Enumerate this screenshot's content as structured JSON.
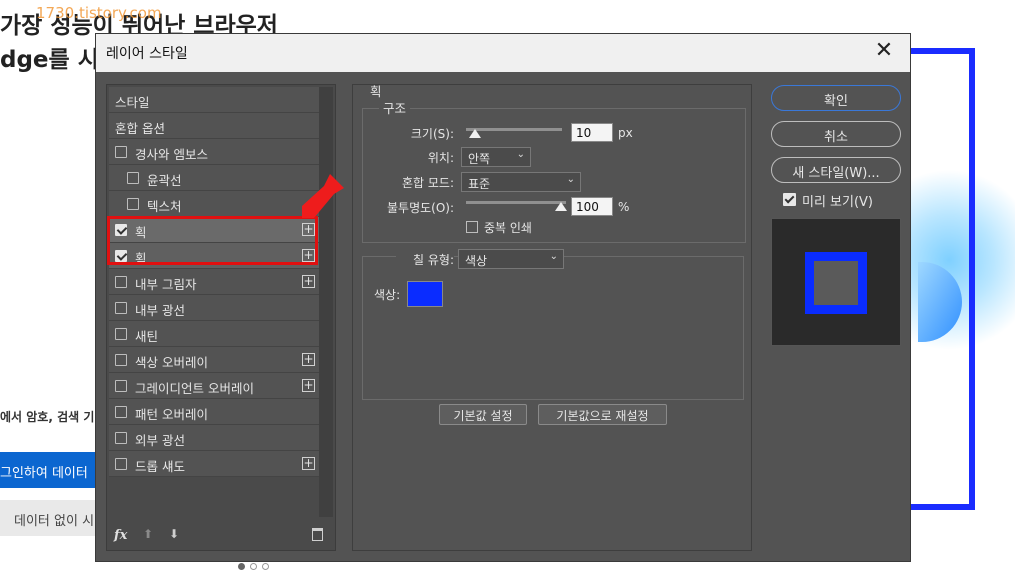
{
  "background": {
    "watermark": "1730.tistory.com",
    "title_line1": "가장 성능이 뛰어난 브라우저",
    "title_line2": "dge를 시작",
    "body_text": "에서 암호, 검색 기",
    "button1": "그인하여 데이터",
    "button2": "데이터 없이 시"
  },
  "dialog": {
    "title": "레이어 스타일",
    "close": "✕"
  },
  "left_list": {
    "items": [
      {
        "label": "스타일",
        "checkbox": false,
        "checked": false,
        "plus": false,
        "indent": 0
      },
      {
        "label": "혼합 옵션",
        "checkbox": false,
        "checked": false,
        "plus": false,
        "indent": 0
      },
      {
        "label": "경사와 엠보스",
        "checkbox": true,
        "checked": false,
        "plus": false,
        "indent": 0
      },
      {
        "label": "윤곽선",
        "checkbox": true,
        "checked": false,
        "plus": false,
        "indent": 1
      },
      {
        "label": "텍스처",
        "checkbox": true,
        "checked": false,
        "plus": false,
        "indent": 1
      },
      {
        "label": "획",
        "checkbox": true,
        "checked": true,
        "plus": true,
        "indent": 0,
        "selected": true
      },
      {
        "label": "획",
        "checkbox": true,
        "checked": true,
        "plus": true,
        "indent": 0,
        "selected": true
      },
      {
        "label": "내부 그림자",
        "checkbox": true,
        "checked": false,
        "plus": true,
        "indent": 0
      },
      {
        "label": "내부 광선",
        "checkbox": true,
        "checked": false,
        "plus": false,
        "indent": 0
      },
      {
        "label": "새틴",
        "checkbox": true,
        "checked": false,
        "plus": false,
        "indent": 0
      },
      {
        "label": "색상 오버레이",
        "checkbox": true,
        "checked": false,
        "plus": true,
        "indent": 0
      },
      {
        "label": "그레이디언트 오버레이",
        "checkbox": true,
        "checked": false,
        "plus": true,
        "indent": 0
      },
      {
        "label": "패턴 오버레이",
        "checkbox": true,
        "checked": false,
        "plus": false,
        "indent": 0
      },
      {
        "label": "외부 광선",
        "checkbox": true,
        "checked": false,
        "plus": false,
        "indent": 0
      },
      {
        "label": "드롭 섀도",
        "checkbox": true,
        "checked": false,
        "plus": true,
        "indent": 0
      }
    ],
    "footer": {
      "fx": "fx",
      "up": "⬆",
      "down": "⬇"
    }
  },
  "stroke": {
    "section_title": "획",
    "structure_title": "구조",
    "size_label": "크기(S):",
    "size_value": "10",
    "size_unit": "px",
    "position_label": "위치:",
    "position_value": "안쪽",
    "blend_label": "혼합 모드:",
    "blend_value": "표준",
    "opacity_label": "불투명도(O):",
    "opacity_value": "100",
    "opacity_unit": "%",
    "overprint_label": "중복 인쇄",
    "fill_type_label": "칠 유형:",
    "fill_type_value": "색상",
    "color_label": "색상:",
    "color_value": "#0a2cff",
    "btn_default": "기본값 설정",
    "btn_reset": "기본값으로 재설정"
  },
  "right": {
    "ok": "확인",
    "cancel": "취소",
    "new_style": "새 스타일(W)...",
    "preview_label": "미리 보기(V)",
    "accent": "#0a2cff"
  }
}
